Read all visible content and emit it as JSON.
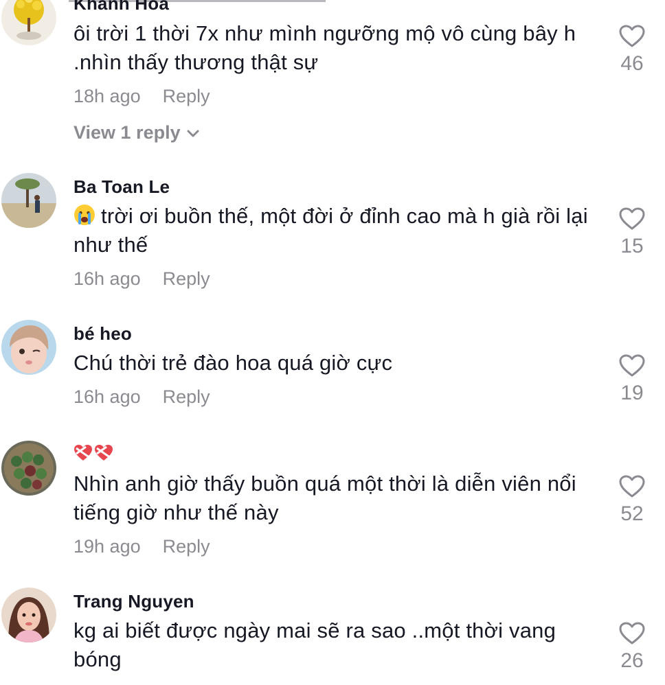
{
  "comments": [
    {
      "username": "Khánh Hòa",
      "text": "ôi trời 1 thời 7x như mình ngưỡng mộ vô cùng bây h .nhìn thấy thương thật sự",
      "time": "18h ago",
      "reply_label": "Reply",
      "likes": "46",
      "view_replies": "View 1 reply"
    },
    {
      "username": "Ba Toan Le",
      "text": "trời ơi buồn thế, một đời ở đỉnh cao mà h già rồi lại như thế",
      "emoji": "crying-face",
      "time": "16h ago",
      "reply_label": "Reply",
      "likes": "15"
    },
    {
      "username": "bé heo",
      "text": "Chú thời trẻ đào hoa quá giờ cực",
      "time": "16h ago",
      "reply_label": "Reply",
      "likes": "19"
    },
    {
      "username_icons": [
        "heart-ribbon-icon",
        "heart-ribbon-icon"
      ],
      "text": "Nhìn anh giờ thấy buồn quá một thời là diễn viên nổi tiếng giờ như thế này",
      "time": "19h ago",
      "reply_label": "Reply",
      "likes": "52"
    },
    {
      "username": "Trang Nguyen",
      "text": "kg ai biết được ngày mai sẽ ra sao ..một thời vang bóng",
      "likes": "26"
    }
  ],
  "colors": {
    "text": "#161823",
    "secondary": "#8a8b91",
    "heart_outline": "#8a8b91"
  }
}
